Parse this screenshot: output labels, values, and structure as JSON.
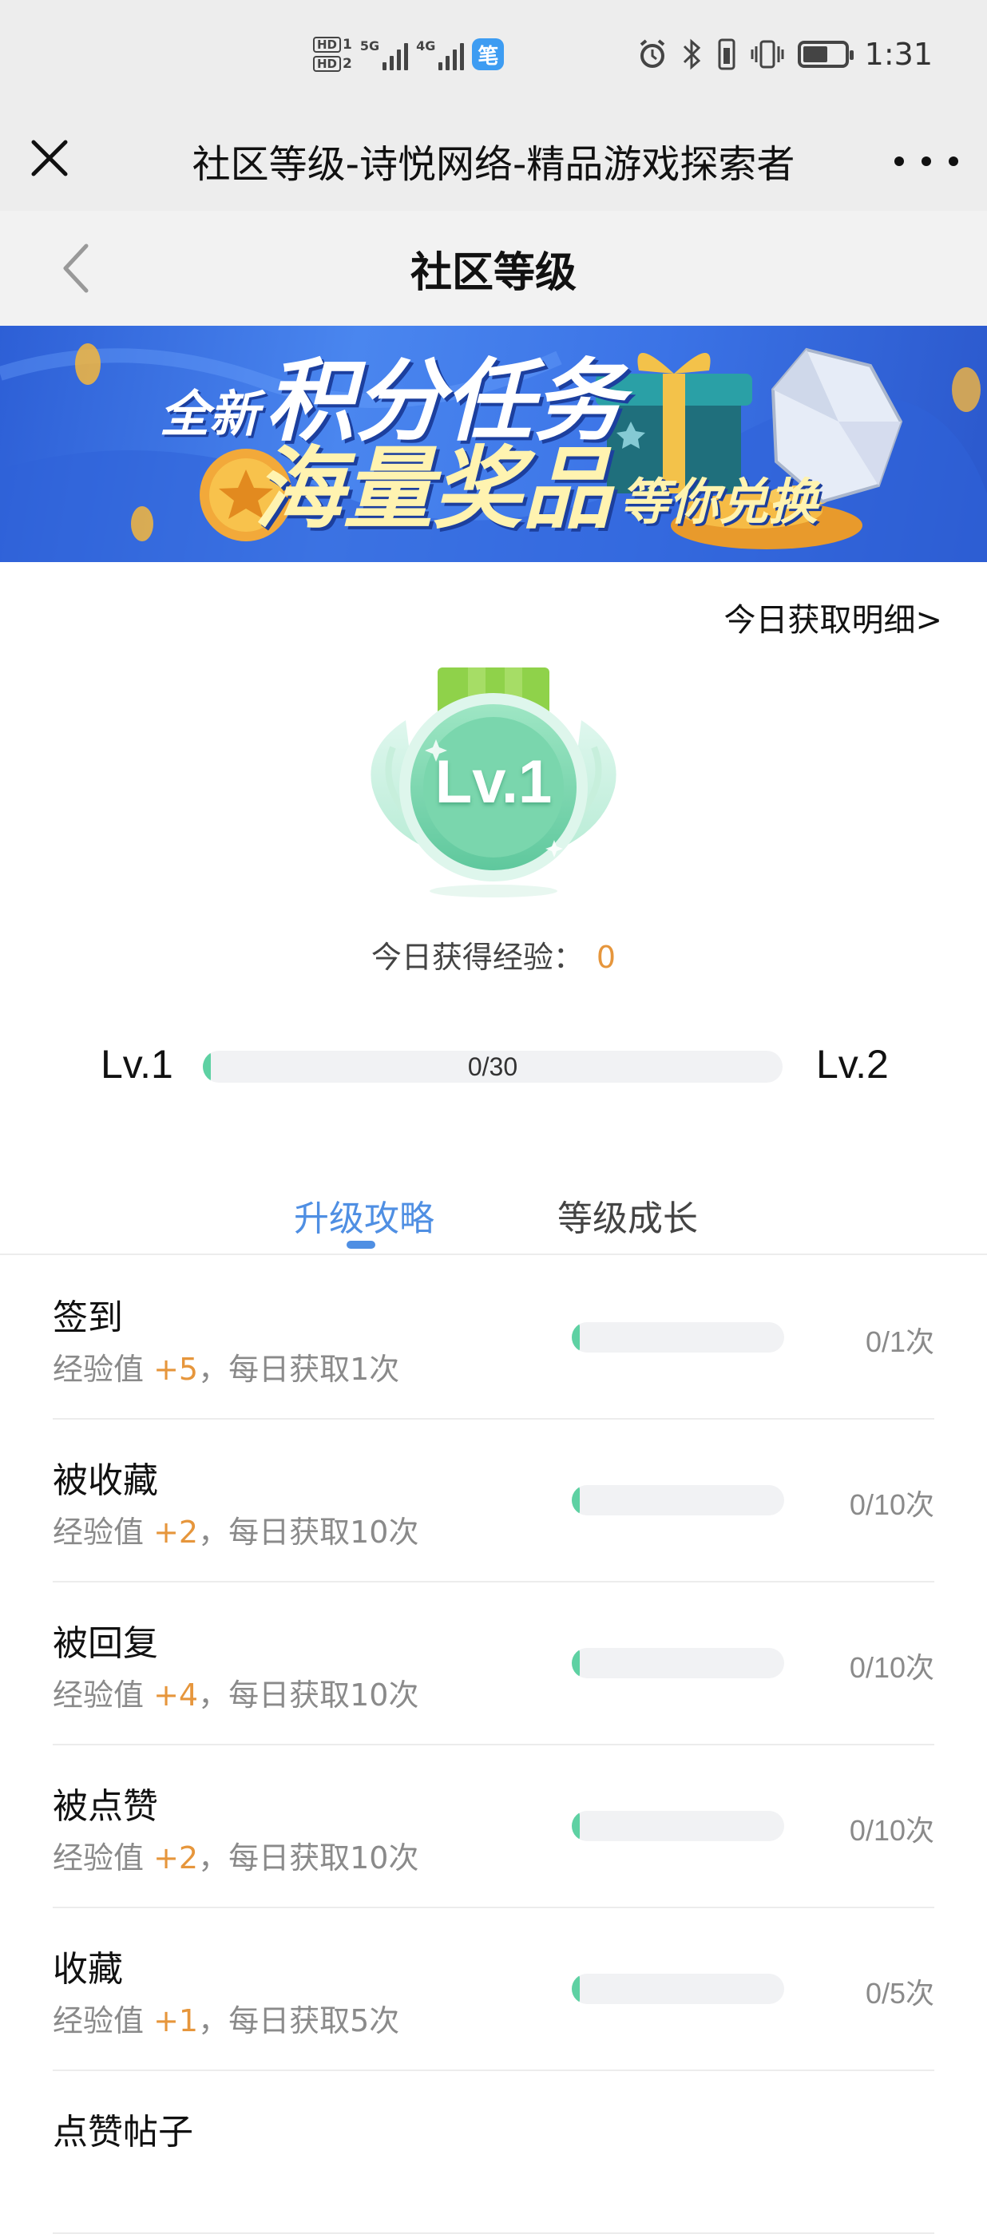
{
  "status_bar": {
    "hd1": "HD",
    "hd1_sub": "1",
    "hd2": "HD",
    "hd2_sub": "2",
    "net1": "5G",
    "net2": "4G",
    "app_badge": "笔",
    "time": "1:31",
    "icons": [
      "alarm-icon",
      "bluetooth-icon",
      "vibrate-icon",
      "battery-icon"
    ]
  },
  "title_bar": {
    "title": "社区等级-诗悦网络-精品游戏探索者",
    "close_icon": "close-icon",
    "more_icon": "more-icon"
  },
  "page_header": {
    "title": "社区等级",
    "back_icon": "chevron-left-icon"
  },
  "banner": {
    "line1_small": "全新",
    "line1_big": "积分任务",
    "line2_big": "海量奖品",
    "line2_small": "等你兑换"
  },
  "level": {
    "today_detail_link": "今日获取明细>",
    "medal_label": "Lv.1",
    "today_exp_label": "今日获得经验：",
    "today_exp_value": "0",
    "current_level": "Lv.1",
    "next_level": "Lv.2",
    "progress_text": "0/30",
    "progress_fraction": 0
  },
  "tabs": [
    {
      "label": "升级攻略",
      "active": true
    },
    {
      "label": "等级成长",
      "active": false
    }
  ],
  "tasks": [
    {
      "name": "签到",
      "desc_prefix": "经验值 ",
      "points": "+5",
      "desc_suffix": "，每日获取1次",
      "count": "0/1次",
      "progress_fraction": 0
    },
    {
      "name": "被收藏",
      "desc_prefix": "经验值 ",
      "points": "+2",
      "desc_suffix": "，每日获取10次",
      "count": "0/10次",
      "progress_fraction": 0
    },
    {
      "name": "被回复",
      "desc_prefix": "经验值 ",
      "points": "+4",
      "desc_suffix": "，每日获取10次",
      "count": "0/10次",
      "progress_fraction": 0
    },
    {
      "name": "被点赞",
      "desc_prefix": "经验值 ",
      "points": "+2",
      "desc_suffix": "，每日获取10次",
      "count": "0/10次",
      "progress_fraction": 0
    },
    {
      "name": "收藏",
      "desc_prefix": "经验值 ",
      "points": "+1",
      "desc_suffix": "，每日获取5次",
      "count": "0/5次",
      "progress_fraction": 0
    },
    {
      "name": "点赞帖子"
    }
  ],
  "colors": {
    "accent_blue": "#4f8fe3",
    "points_orange": "#e6963c",
    "progress_green": "#5ed1a3",
    "track_gray": "#f1f2f4"
  }
}
